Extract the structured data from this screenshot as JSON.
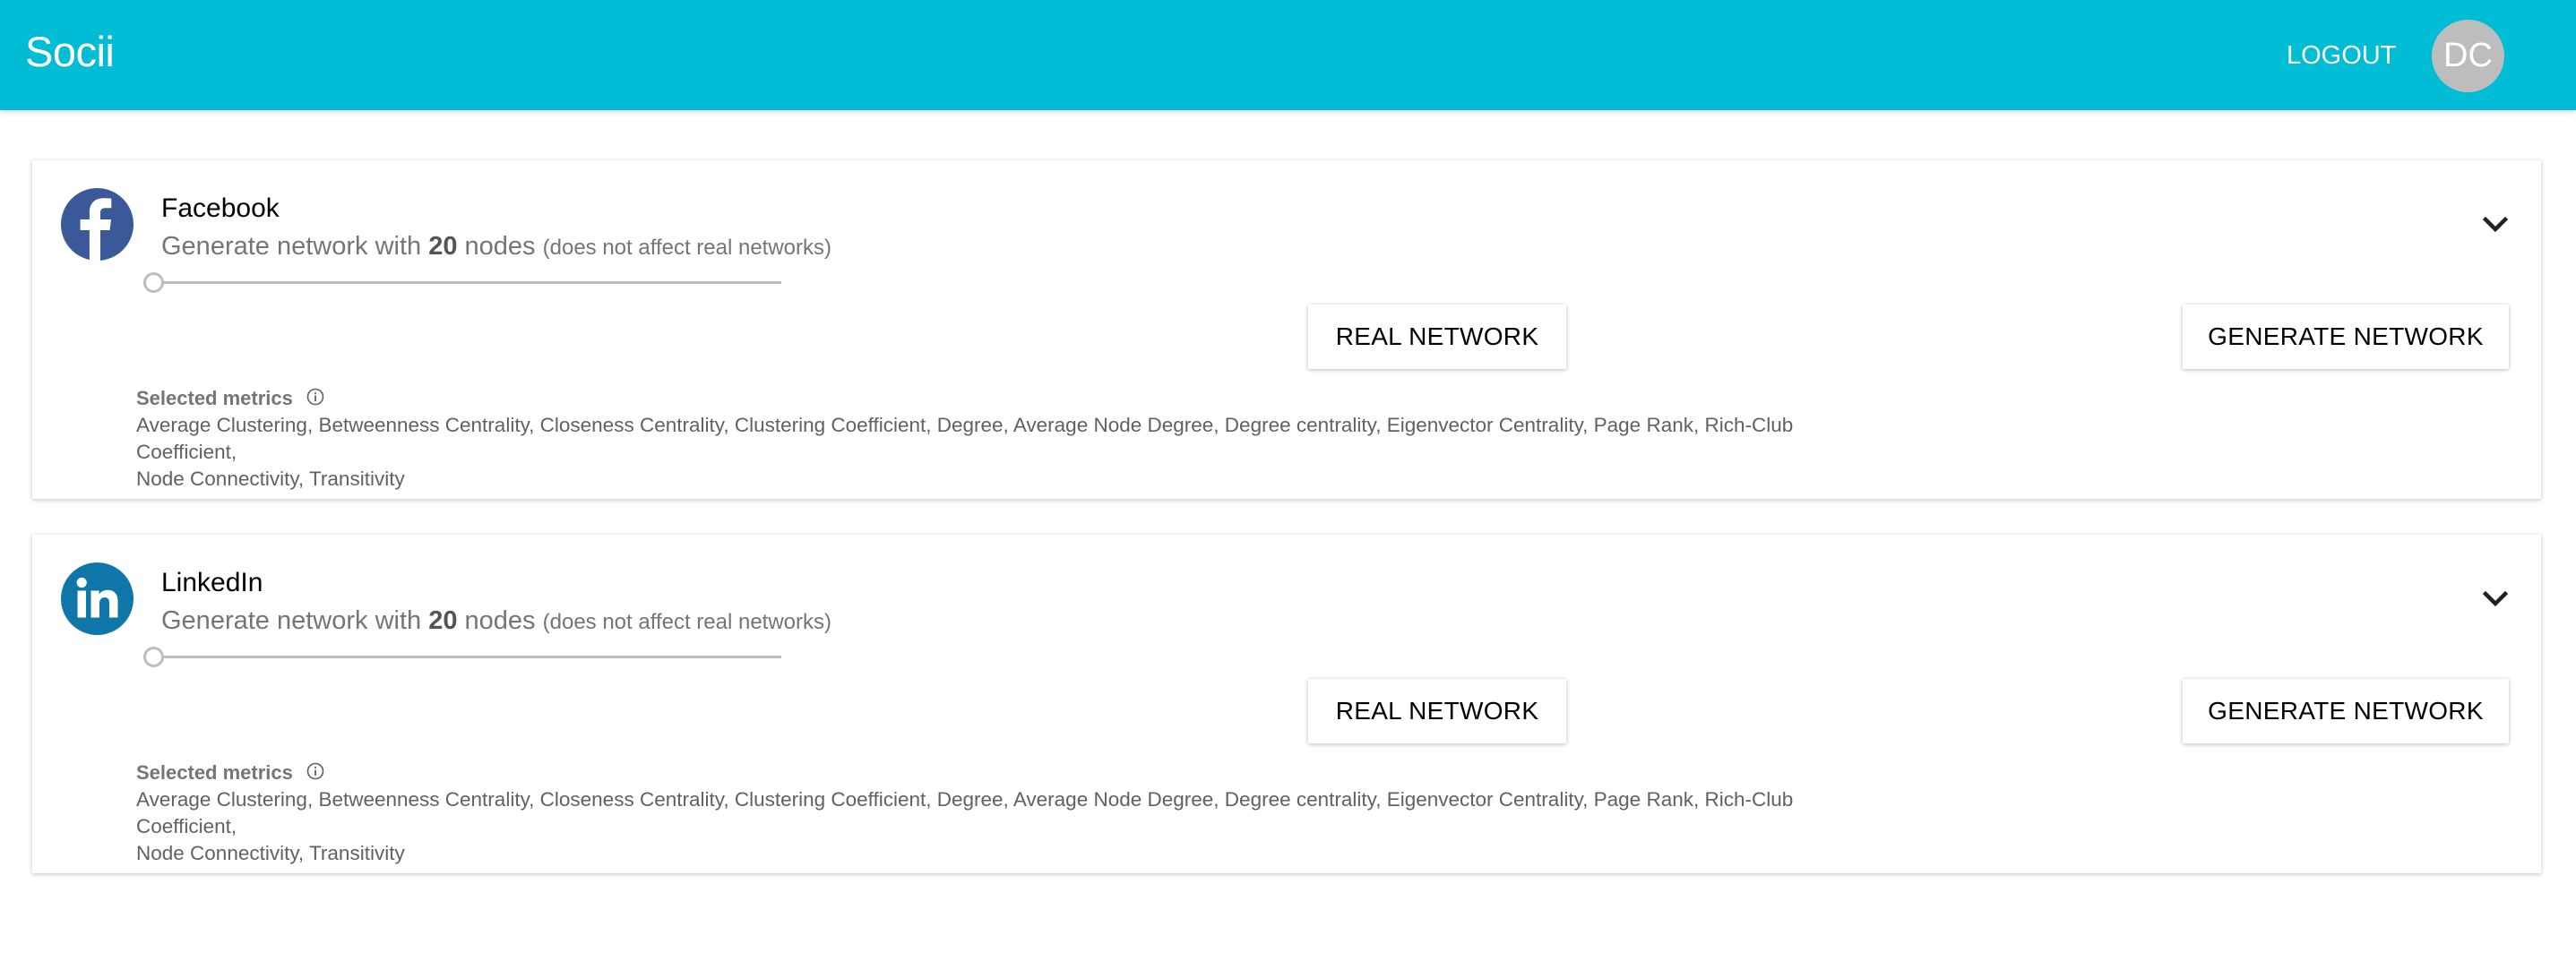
{
  "app": {
    "title": "Socii",
    "logout_label": "LOGOUT",
    "avatar_initials": "DC",
    "primary_color": "#00bcd4"
  },
  "cards": [
    {
      "platform": "Facebook",
      "logo_icon": "facebook-logo",
      "logo_color": "#3b5998",
      "subtitle_prefix": "Generate network with",
      "node_count": "20",
      "subtitle_suffix": "nodes",
      "subtitle_note": "(does not affect real networks)",
      "slider_value": 0,
      "real_network_label": "REAL NETWORK",
      "generate_network_label": "GENERATE NETWORK",
      "metrics_label": "Selected metrics",
      "metrics_line1": "Average Clustering, Betweenness Centrality, Closeness Centrality, Clustering Coefficient, Degree, Average Node Degree, Degree centrality, Eigenvector Centrality, Page Rank, Rich-Club Coefficient,",
      "metrics_line2": "Node Connectivity, Transitivity"
    },
    {
      "platform": "LinkedIn",
      "logo_icon": "linkedin-logo",
      "logo_color": "#0e76a8",
      "subtitle_prefix": "Generate network with",
      "node_count": "20",
      "subtitle_suffix": "nodes",
      "subtitle_note": "(does not affect real networks)",
      "slider_value": 0,
      "real_network_label": "REAL NETWORK",
      "generate_network_label": "GENERATE NETWORK",
      "metrics_label": "Selected metrics",
      "metrics_line1": "Average Clustering, Betweenness Centrality, Closeness Centrality, Clustering Coefficient, Degree, Average Node Degree, Degree centrality, Eigenvector Centrality, Page Rank, Rich-Club Coefficient,",
      "metrics_line2": "Node Connectivity, Transitivity"
    }
  ]
}
